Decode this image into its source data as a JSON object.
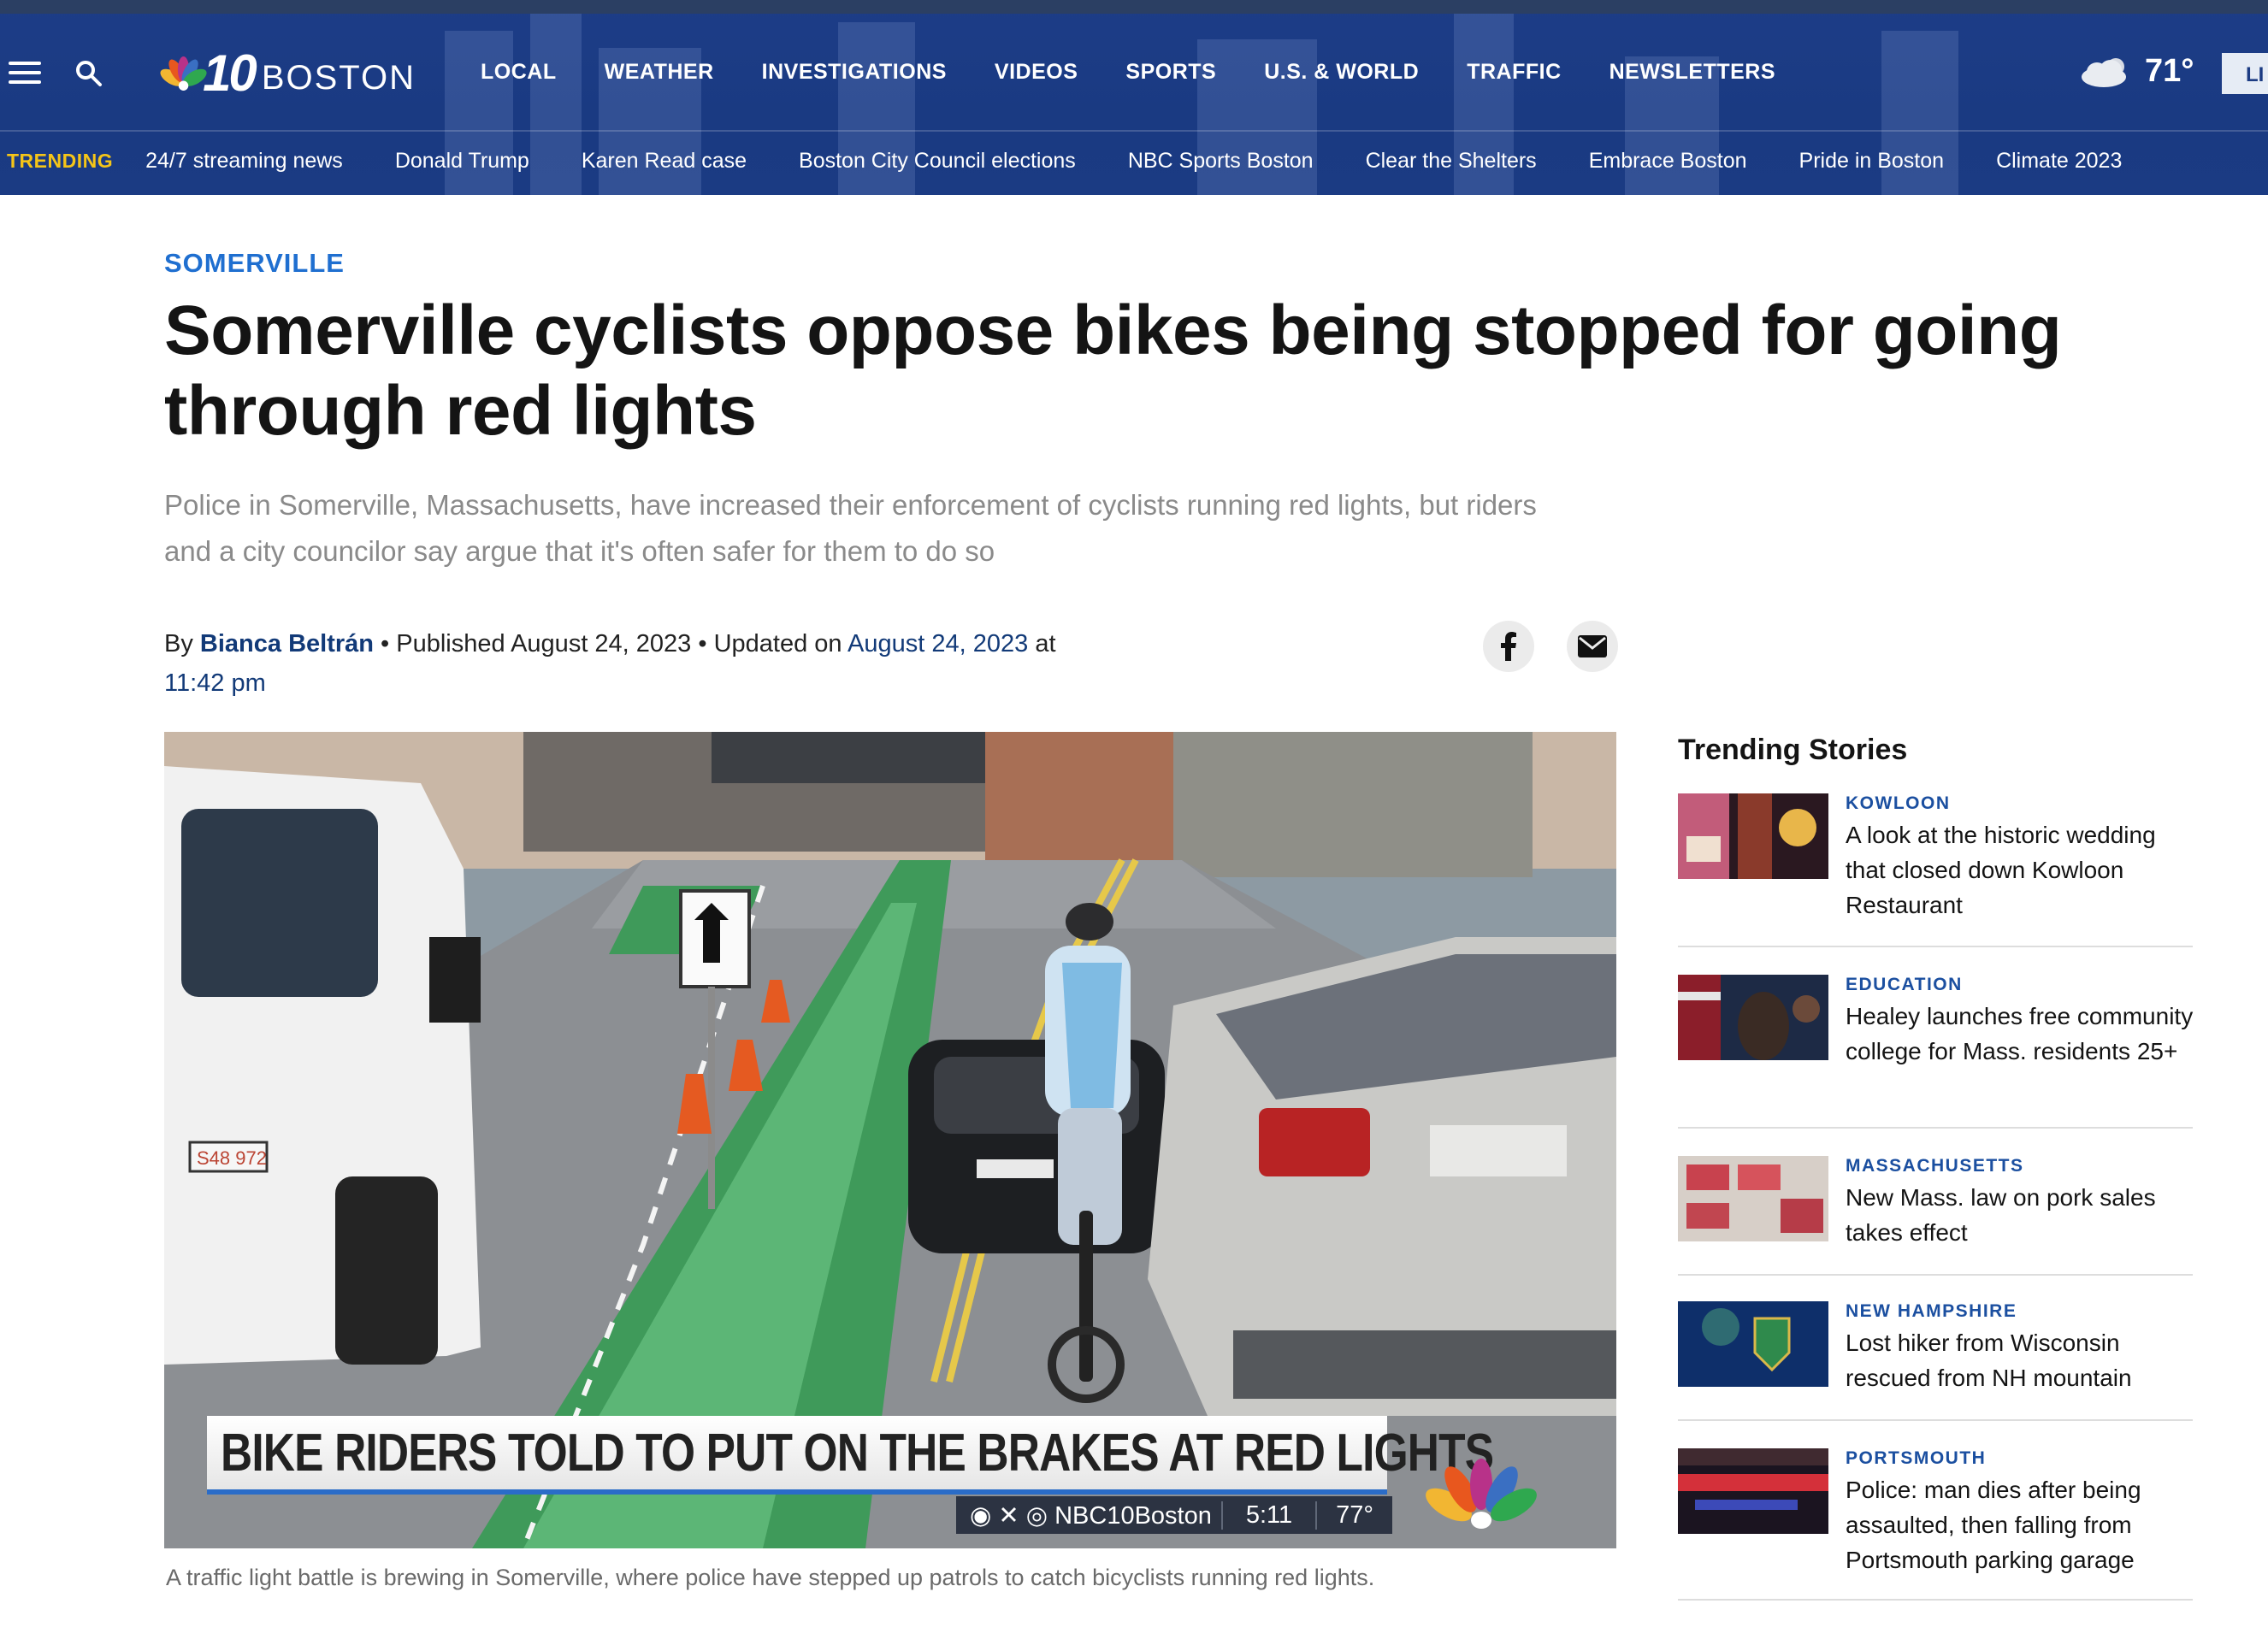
{
  "header": {
    "logo_number": "10",
    "logo_city": "BOSTON",
    "nav": [
      "LOCAL",
      "WEATHER",
      "INVESTIGATIONS",
      "VIDEOS",
      "SPORTS",
      "U.S. & WORLD",
      "TRAFFIC",
      "NEWSLETTERS"
    ],
    "weather_temp": "71°",
    "weather_icon": "partly-cloudy-icon",
    "live_label": "LI",
    "trending_label": "TRENDING",
    "trending": [
      "24/7 streaming news",
      "Donald Trump",
      "Karen Read case",
      "Boston City Council elections",
      "NBC Sports Boston",
      "Clear the Shelters",
      "Embrace Boston",
      "Pride in Boston",
      "Climate 2023"
    ]
  },
  "article": {
    "category": "SOMERVILLE",
    "headline": "Somerville cyclists oppose bikes being stopped for going through red lights",
    "dek": "Police in Somerville, Massachusetts, have increased their enforcement of cyclists running red lights, but riders and a city councilor say argue that it's often safer for them to do so",
    "byline_prefix": "By",
    "author": "Bianca Beltrán",
    "published": "• Published August 24, 2023 • Updated on",
    "updated_date": "August 24, 2023",
    "updated_at": "at",
    "updated_time": "11:42 pm",
    "lower_third": "BIKE RIDERS TOLD TO PUT ON THE BRAKES AT RED LIGHTS",
    "lower_third_handle": "NBC10Boston",
    "lower_third_time": "5:11",
    "lower_third_temp": "77°",
    "van_plate": "S48 972",
    "caption": "A traffic light battle is brewing in Somerville, where police have stepped up patrols to catch bicyclists running red lights."
  },
  "sidebar": {
    "title": "Trending Stories",
    "stories": [
      {
        "tag": "KOWLOON",
        "title": "A look at the historic wedding that closed down Kowloon Restaurant"
      },
      {
        "tag": "EDUCATION",
        "title": "Healey launches free community college for Mass. residents 25+"
      },
      {
        "tag": "MASSACHUSETTS",
        "title": "New Mass. law on pork sales takes effect"
      },
      {
        "tag": "NEW HAMPSHIRE",
        "title": "Lost hiker from Wisconsin rescued from NH mountain"
      },
      {
        "tag": "PORTSMOUTH",
        "title": "Police: man dies after being assaulted, then falling from Portsmouth parking garage"
      }
    ]
  },
  "colors": {
    "header_bg": "#1b3b83",
    "trending_label": "#f5c518",
    "category": "#1f6fd0",
    "link": "#123a78"
  }
}
